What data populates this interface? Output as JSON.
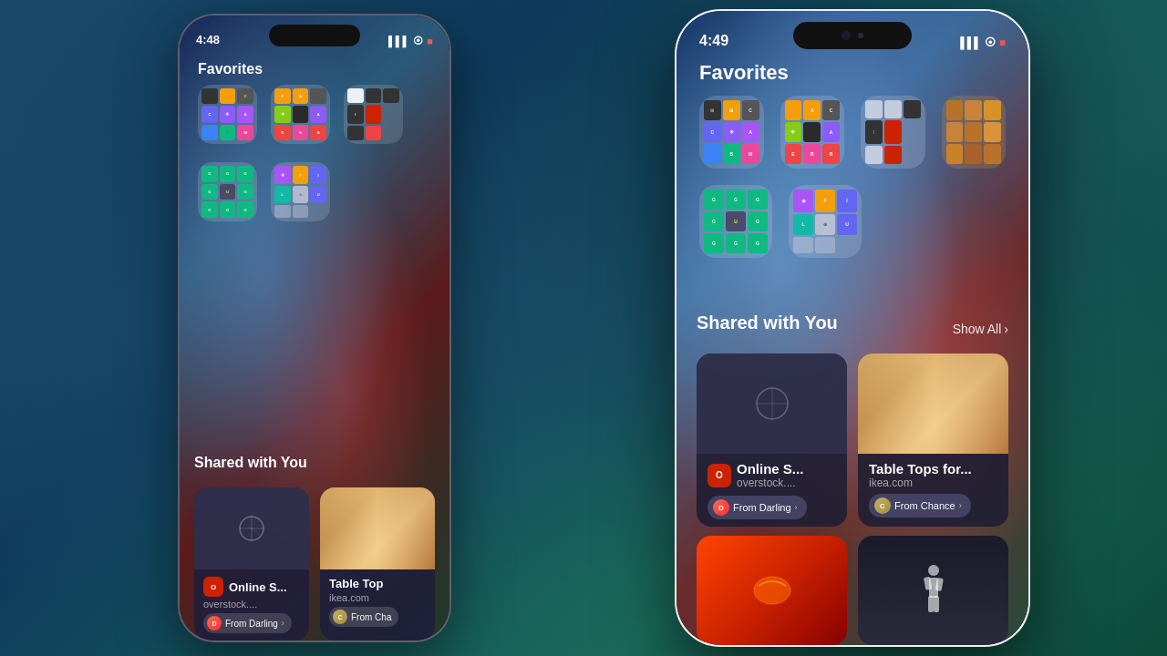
{
  "background": {
    "gradient": "teal-blue-dark"
  },
  "phone_back": {
    "time": "4:48",
    "location_icon": "▲",
    "status_icons": [
      "signal",
      "wifi",
      "battery"
    ],
    "favorites_label": "Favorites",
    "shared_with_you_label": "Shared with You",
    "cards": [
      {
        "title": "Online S...",
        "subtitle": "overstock....",
        "from": "From Darling",
        "type": "safari"
      },
      {
        "title": "Table Top",
        "subtitle": "ikea.com",
        "from": "From Cha",
        "type": "wood"
      }
    ]
  },
  "phone_front": {
    "time": "4:49",
    "location_icon": "▲",
    "status_icons": [
      "signal",
      "wifi",
      "battery"
    ],
    "favorites_label": "Favorites",
    "shared_with_you_label": "Shared with You",
    "show_all_label": "Show All",
    "cards": [
      {
        "title": "Online S...",
        "subtitle": "overstock....",
        "from": "From Darling",
        "from_initial": "D",
        "type": "safari"
      },
      {
        "title": "Table Tops for...",
        "subtitle": "ikea.com",
        "from": "From Chance",
        "from_initial": "C",
        "type": "wood"
      }
    ],
    "bottom_cards": [
      {
        "type": "sports",
        "label": ""
      },
      {
        "type": "figure",
        "label": ""
      }
    ]
  },
  "app_folders": {
    "folder1": [
      "c16",
      "c5",
      "c1",
      "c9",
      "c2",
      "c13",
      "c3",
      "c4",
      "c7"
    ],
    "folder2": [
      "c5",
      "c5",
      "c1",
      "c4",
      "c11",
      "c2",
      "c6",
      "c7",
      "c6"
    ],
    "folder3": [
      "c15",
      "c16",
      "c16",
      "c16",
      "c10",
      "c6",
      "c16",
      "c6",
      "c0"
    ],
    "folder4": [
      "c4",
      "c4",
      "c4",
      "c4",
      "c18",
      "c4",
      "c4",
      "c4",
      "c4"
    ],
    "folder5": [
      "c11",
      "c5",
      "c9",
      "c9",
      "c4",
      "c9",
      "c9",
      "c9",
      "c4"
    ],
    "folder6": [
      "c13",
      "c5",
      "c9",
      "c8",
      "c15",
      "c9",
      "c15",
      "c15",
      "c0"
    ]
  }
}
